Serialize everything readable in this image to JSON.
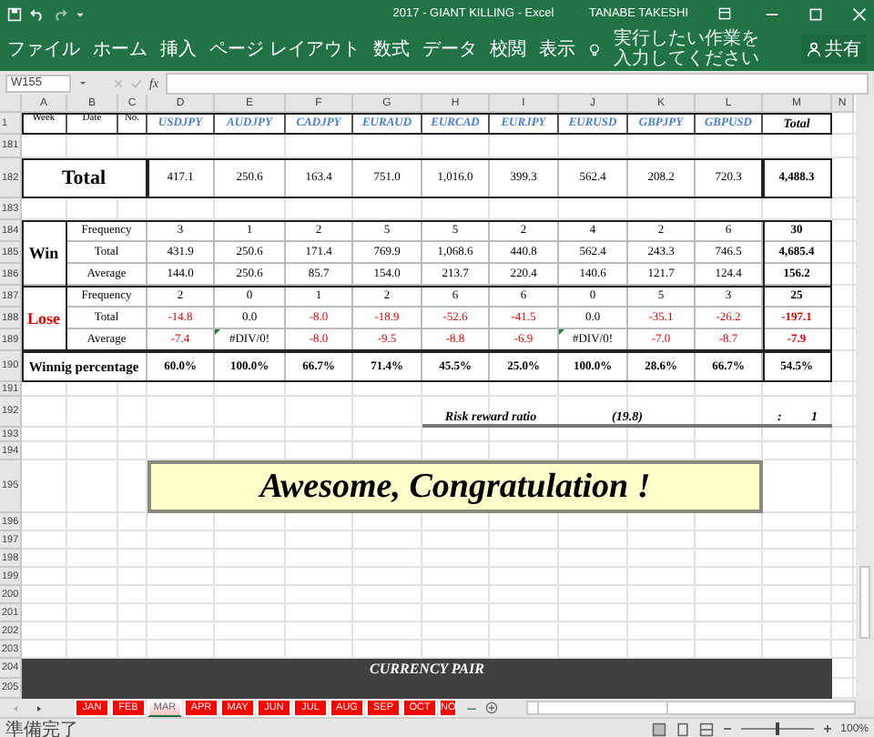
{
  "window": {
    "title": "2017 - GIANT KILLING  -  Excel",
    "user": "TANABE TAKESHI"
  },
  "ribbon": {
    "tabs": [
      "ファイル",
      "ホーム",
      "挿入",
      "ページ レイアウト",
      "数式",
      "データ",
      "校閲",
      "表示"
    ],
    "tell_me": "実行したい作業を入力してください",
    "share": "共有"
  },
  "formula_bar": {
    "name_box": "W155",
    "fx": "fx"
  },
  "sheet": {
    "column_letters": [
      "A",
      "B",
      "C",
      "D",
      "E",
      "F",
      "G",
      "H",
      "I",
      "J",
      "K",
      "L",
      "M",
      "N"
    ],
    "row_numbers": [
      "1",
      "181",
      "182",
      "183",
      "184",
      "185",
      "186",
      "187",
      "188",
      "189",
      "190",
      "191",
      "192",
      "193",
      "194",
      "195",
      "196",
      "197",
      "198",
      "199",
      "200",
      "201",
      "202",
      "203",
      "204",
      "205"
    ],
    "header": {
      "week": "Week",
      "date": "Date",
      "no": "No.",
      "pairs": [
        "USDJPY",
        "AUDJPY",
        "CADJPY",
        "EURAUD",
        "EURCAD",
        "EURJPY",
        "EURUSD",
        "GBPJPY",
        "GBPUSD"
      ],
      "total": "Total"
    },
    "total_row": {
      "label": "Total",
      "values": [
        "417.1",
        "250.6",
        "163.4",
        "751.0",
        "1,016.0",
        "399.3",
        "562.4",
        "208.2",
        "720.3"
      ],
      "total": "4,488.3"
    },
    "win": {
      "label": "Win",
      "rows": [
        {
          "label": "Frequency",
          "values": [
            "3",
            "1",
            "2",
            "5",
            "5",
            "2",
            "4",
            "2",
            "6"
          ],
          "total": "30"
        },
        {
          "label": "Total",
          "values": [
            "431.9",
            "250.6",
            "171.4",
            "769.9",
            "1,068.6",
            "440.8",
            "562.4",
            "243.3",
            "746.5"
          ],
          "total": "4,685.4"
        },
        {
          "label": "Average",
          "values": [
            "144.0",
            "250.6",
            "85.7",
            "154.0",
            "213.7",
            "220.4",
            "140.6",
            "121.7",
            "124.4"
          ],
          "total": "156.2"
        }
      ]
    },
    "lose": {
      "label": "Lose",
      "rows": [
        {
          "label": "Frequency",
          "values": [
            {
              "text": "2",
              "negative": false,
              "flagged": false
            },
            {
              "text": "0",
              "negative": false,
              "flagged": false
            },
            {
              "text": "1",
              "negative": false,
              "flagged": false
            },
            {
              "text": "2",
              "negative": false,
              "flagged": false
            },
            {
              "text": "6",
              "negative": false,
              "flagged": false
            },
            {
              "text": "6",
              "negative": false,
              "flagged": false
            },
            {
              "text": "0",
              "negative": false,
              "flagged": false
            },
            {
              "text": "5",
              "negative": false,
              "flagged": false
            },
            {
              "text": "3",
              "negative": false,
              "flagged": false
            }
          ],
          "total": {
            "text": "25",
            "negative": false
          }
        },
        {
          "label": "Total",
          "values": [
            {
              "text": "-14.8",
              "negative": true,
              "flagged": false
            },
            {
              "text": "0.0",
              "negative": false,
              "flagged": false
            },
            {
              "text": "-8.0",
              "negative": true,
              "flagged": false
            },
            {
              "text": "-18.9",
              "negative": true,
              "flagged": false
            },
            {
              "text": "-52.6",
              "negative": true,
              "flagged": false
            },
            {
              "text": "-41.5",
              "negative": true,
              "flagged": false
            },
            {
              "text": "0.0",
              "negative": false,
              "flagged": false
            },
            {
              "text": "-35.1",
              "negative": true,
              "flagged": false
            },
            {
              "text": "-26.2",
              "negative": true,
              "flagged": false
            }
          ],
          "total": {
            "text": "-197.1",
            "negative": true
          }
        },
        {
          "label": "Average",
          "values": [
            {
              "text": "-7.4",
              "negative": true,
              "flagged": false
            },
            {
              "text": "#DIV/0!",
              "negative": false,
              "flagged": true
            },
            {
              "text": "-8.0",
              "negative": true,
              "flagged": false
            },
            {
              "text": "-9.5",
              "negative": true,
              "flagged": false
            },
            {
              "text": "-8.8",
              "negative": true,
              "flagged": false
            },
            {
              "text": "-6.9",
              "negative": true,
              "flagged": false
            },
            {
              "text": "#DIV/0!",
              "negative": false,
              "flagged": true
            },
            {
              "text": "-7.0",
              "negative": true,
              "flagged": false
            },
            {
              "text": "-8.7",
              "negative": true,
              "flagged": false
            }
          ],
          "total": {
            "text": "-7.9",
            "negative": true
          }
        }
      ]
    },
    "winning_percentage": {
      "label": "Winnig percentage",
      "values": [
        "60.0%",
        "100.0%",
        "66.7%",
        "71.4%",
        "45.5%",
        "25.0%",
        "100.0%",
        "28.6%",
        "66.7%"
      ],
      "total": "54.5%"
    },
    "risk_reward": {
      "label": "Risk reward ratio",
      "value": "(19.8)",
      "separator": ":",
      "ratio": "1"
    },
    "banner": "Awesome, Congratulation !",
    "currency_pair": "CURRENCY PAIR"
  },
  "sheet_tabs": [
    {
      "label": "JAN",
      "selected": false
    },
    {
      "label": "FEB",
      "selected": false
    },
    {
      "label": "MAR",
      "selected": true
    },
    {
      "label": "APR",
      "selected": false
    },
    {
      "label": "MAY",
      "selected": false
    },
    {
      "label": "JUN",
      "selected": false
    },
    {
      "label": "JUL",
      "selected": false
    },
    {
      "label": "AUG",
      "selected": false
    },
    {
      "label": "SEP",
      "selected": false
    },
    {
      "label": "OCT",
      "selected": false
    },
    {
      "label": "NO",
      "selected": false
    }
  ],
  "status_bar": {
    "status": "準備完了",
    "zoom_slider": {
      "level": 0.5
    },
    "zoom": "100%"
  }
}
